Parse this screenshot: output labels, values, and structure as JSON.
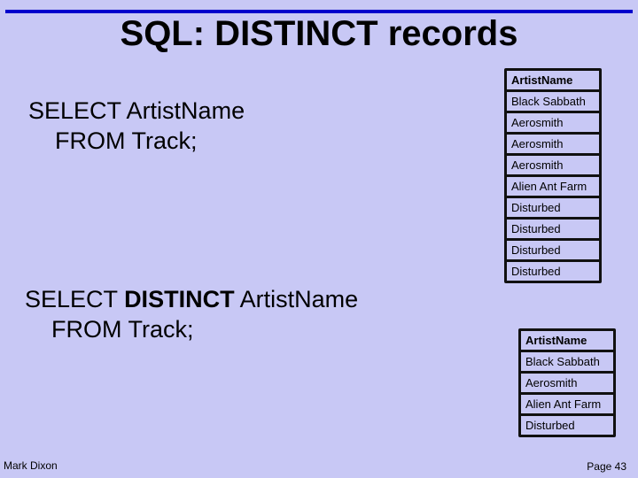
{
  "slide": {
    "title": "SQL: DISTINCT records",
    "query1": {
      "line1": "SELECT ArtistName",
      "line2": "FROM Track;"
    },
    "query2": {
      "select": "SELECT ",
      "distinct": "DISTINCT",
      "rest": " ArtistName",
      "line2": "FROM Track;"
    },
    "table1": {
      "header": "ArtistName",
      "rows": [
        "Black Sabbath",
        "Aerosmith",
        "Aerosmith",
        "Aerosmith",
        "Alien Ant Farm",
        "Disturbed",
        "Disturbed",
        "Disturbed",
        "Disturbed"
      ]
    },
    "table2": {
      "header": "ArtistName",
      "rows": [
        "Black Sabbath",
        "Aerosmith",
        "Alien Ant Farm",
        "Disturbed"
      ]
    },
    "footer": {
      "author": "Mark Dixon",
      "page": "Page 43"
    },
    "colors": {
      "background": "#c8c8f5",
      "accent_line": "#0000cc"
    }
  }
}
